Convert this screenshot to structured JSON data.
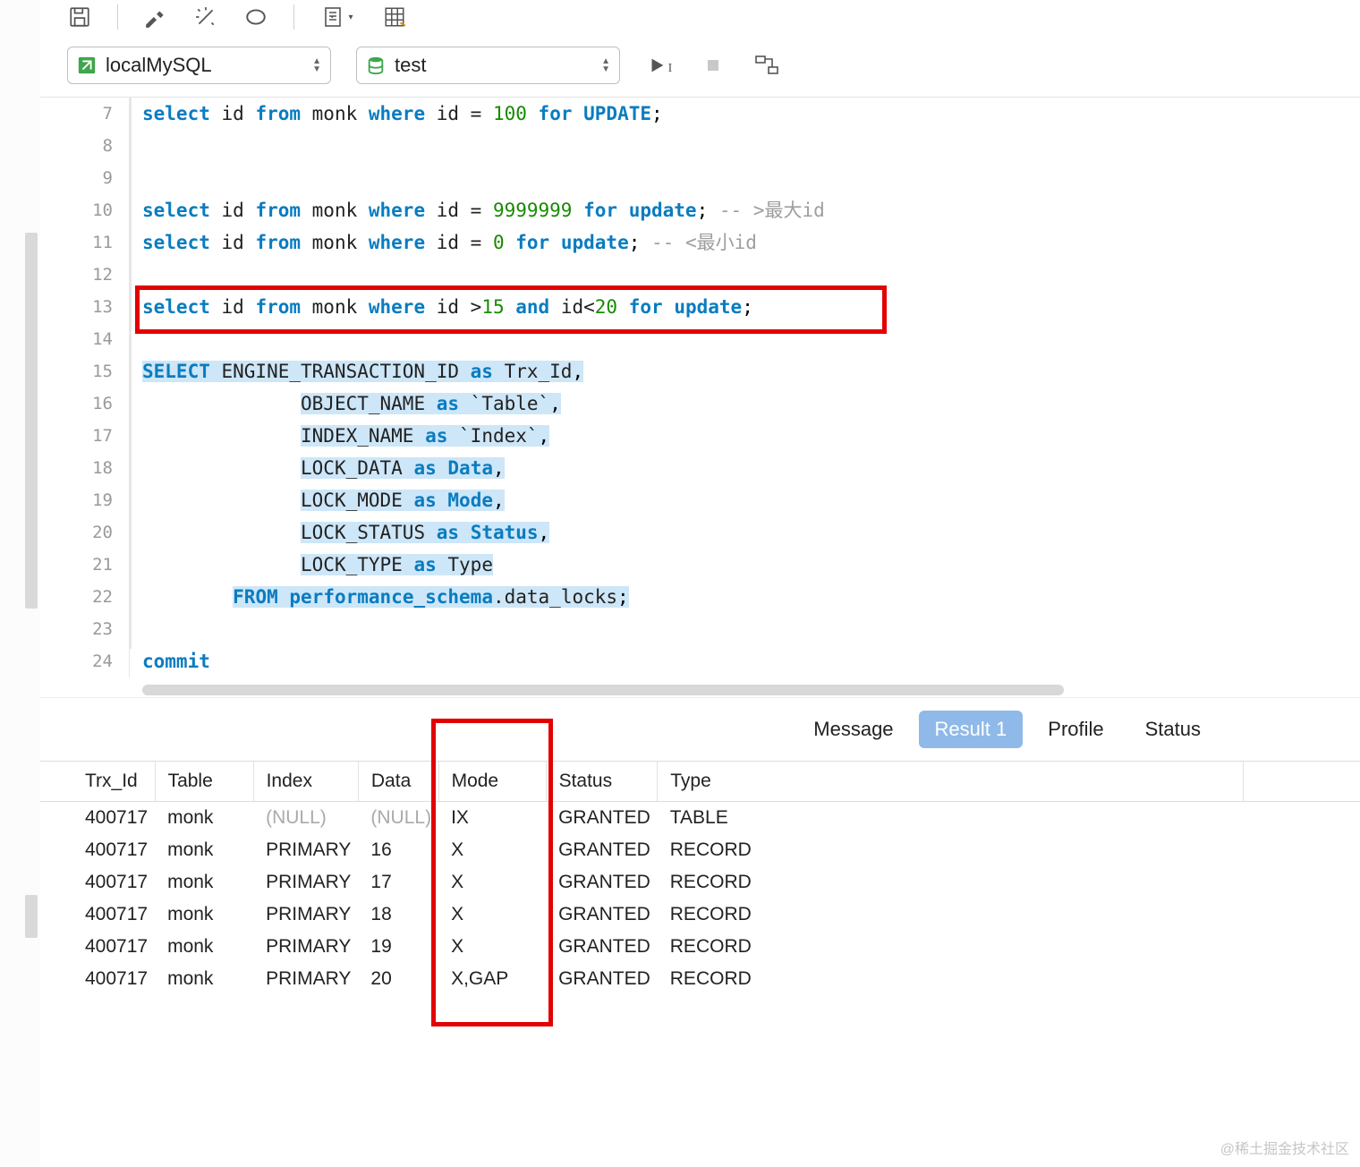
{
  "toolbar": {
    "connection": "localMySQL",
    "database": "test"
  },
  "icons": {
    "save": "save-icon",
    "hammer": "hammer-icon",
    "magic": "magic-icon",
    "loop": "loop-icon",
    "newdoc": "newdoc-icon",
    "sheet": "sheet-icon",
    "run": "run-icon",
    "stop": "stop-icon",
    "plan": "plan-icon",
    "db": "db-icon",
    "conn": "conn-icon"
  },
  "editor": {
    "first_line_no": 7,
    "lines": [
      {
        "n": 7,
        "tokens": [
          [
            "kw",
            "select"
          ],
          [
            "plain",
            " id "
          ],
          [
            "kw",
            "from"
          ],
          [
            "plain",
            " monk "
          ],
          [
            "kw",
            "where"
          ],
          [
            "plain",
            " id = "
          ],
          [
            "num",
            "100"
          ],
          [
            "plain",
            " "
          ],
          [
            "kw",
            "for"
          ],
          [
            "plain",
            " "
          ],
          [
            "kw",
            "UPDATE"
          ],
          [
            "punc",
            ";"
          ]
        ]
      },
      {
        "n": 8,
        "tokens": []
      },
      {
        "n": 9,
        "tokens": []
      },
      {
        "n": 10,
        "tokens": [
          [
            "kw",
            "select"
          ],
          [
            "plain",
            " id "
          ],
          [
            "kw",
            "from"
          ],
          [
            "plain",
            " monk "
          ],
          [
            "kw",
            "where"
          ],
          [
            "plain",
            " id = "
          ],
          [
            "num",
            "9999999"
          ],
          [
            "plain",
            " "
          ],
          [
            "kw",
            "for"
          ],
          [
            "plain",
            " "
          ],
          [
            "kw",
            "update"
          ],
          [
            "punc",
            ";"
          ],
          [
            "plain",
            " "
          ],
          [
            "cmt",
            "-- >最大id"
          ]
        ]
      },
      {
        "n": 11,
        "tokens": [
          [
            "kw",
            "select"
          ],
          [
            "plain",
            " id "
          ],
          [
            "kw",
            "from"
          ],
          [
            "plain",
            " monk "
          ],
          [
            "kw",
            "where"
          ],
          [
            "plain",
            " id = "
          ],
          [
            "num",
            "0"
          ],
          [
            "plain",
            " "
          ],
          [
            "kw",
            "for"
          ],
          [
            "plain",
            " "
          ],
          [
            "kw",
            "update"
          ],
          [
            "punc",
            ";"
          ],
          [
            "plain",
            " "
          ],
          [
            "cmt",
            "-- <最小id"
          ]
        ]
      },
      {
        "n": 12,
        "tokens": []
      },
      {
        "n": 13,
        "highlight": true,
        "tokens": [
          [
            "kw",
            "select"
          ],
          [
            "plain",
            " id "
          ],
          [
            "kw",
            "from"
          ],
          [
            "plain",
            " monk "
          ],
          [
            "kw",
            "where"
          ],
          [
            "plain",
            " id >"
          ],
          [
            "num",
            "15"
          ],
          [
            "plain",
            " "
          ],
          [
            "kw",
            "and"
          ],
          [
            "plain",
            " id<"
          ],
          [
            "num",
            "20"
          ],
          [
            "plain",
            " "
          ],
          [
            "kw",
            "for"
          ],
          [
            "plain",
            " "
          ],
          [
            "kw",
            "update"
          ],
          [
            "punc",
            ";"
          ]
        ]
      },
      {
        "n": 14,
        "tokens": []
      },
      {
        "n": 15,
        "selected": true,
        "tokens": [
          [
            "kw",
            "SELECT"
          ],
          [
            "plain",
            " ENGINE_TRANSACTION_ID "
          ],
          [
            "kw",
            "as"
          ],
          [
            "plain",
            " Trx_Id"
          ],
          [
            "punc",
            ","
          ]
        ]
      },
      {
        "n": 16,
        "selected": true,
        "indent": "              ",
        "tokens": [
          [
            "plain",
            "OBJECT_NAME "
          ],
          [
            "kw",
            "as"
          ],
          [
            "plain",
            " `Table`"
          ],
          [
            "punc",
            ","
          ]
        ]
      },
      {
        "n": 17,
        "selected": true,
        "indent": "              ",
        "tokens": [
          [
            "plain",
            "INDEX_NAME "
          ],
          [
            "kw",
            "as"
          ],
          [
            "plain",
            " `Index`"
          ],
          [
            "punc",
            ","
          ]
        ]
      },
      {
        "n": 18,
        "selected": true,
        "indent": "              ",
        "tokens": [
          [
            "plain",
            "LOCK_DATA "
          ],
          [
            "kw",
            "as"
          ],
          [
            "plain",
            " "
          ],
          [
            "kw",
            "Data"
          ],
          [
            "punc",
            ","
          ]
        ]
      },
      {
        "n": 19,
        "selected": true,
        "indent": "              ",
        "tokens": [
          [
            "plain",
            "LOCK_MODE "
          ],
          [
            "kw",
            "as"
          ],
          [
            "plain",
            " "
          ],
          [
            "kw",
            "Mode"
          ],
          [
            "punc",
            ","
          ]
        ]
      },
      {
        "n": 20,
        "selected": true,
        "indent": "              ",
        "tokens": [
          [
            "plain",
            "LOCK_STATUS "
          ],
          [
            "kw",
            "as"
          ],
          [
            "plain",
            " "
          ],
          [
            "kw",
            "Status"
          ],
          [
            "punc",
            ","
          ]
        ]
      },
      {
        "n": 21,
        "selected": true,
        "indent": "              ",
        "tokens": [
          [
            "plain",
            "LOCK_TYPE "
          ],
          [
            "kw",
            "as"
          ],
          [
            "plain",
            " Type"
          ]
        ]
      },
      {
        "n": 22,
        "selected": true,
        "indent": "        ",
        "tokens": [
          [
            "kw",
            "FROM"
          ],
          [
            "plain",
            " "
          ],
          [
            "kw",
            "performance_schema"
          ],
          [
            "plain",
            ".data_locks"
          ],
          [
            "punc",
            ";"
          ]
        ]
      },
      {
        "n": 23,
        "tokens": []
      },
      {
        "n": 24,
        "tokens": [
          [
            "kw",
            "commit"
          ]
        ]
      }
    ]
  },
  "tabs": [
    {
      "label": "Message",
      "active": false
    },
    {
      "label": "Result 1",
      "active": true
    },
    {
      "label": "Profile",
      "active": false
    },
    {
      "label": "Status",
      "active": false
    }
  ],
  "results": {
    "columns": [
      "Trx_Id",
      "Table",
      "Index",
      "Data",
      "Mode",
      "Status",
      "Type"
    ],
    "rows": [
      [
        "400717",
        "monk",
        "(NULL)",
        "(NULL)",
        "IX",
        "GRANTED",
        "TABLE"
      ],
      [
        "400717",
        "monk",
        "PRIMARY",
        "16",
        "X",
        "GRANTED",
        "RECORD"
      ],
      [
        "400717",
        "monk",
        "PRIMARY",
        "17",
        "X",
        "GRANTED",
        "RECORD"
      ],
      [
        "400717",
        "monk",
        "PRIMARY",
        "18",
        "X",
        "GRANTED",
        "RECORD"
      ],
      [
        "400717",
        "monk",
        "PRIMARY",
        "19",
        "X",
        "GRANTED",
        "RECORD"
      ],
      [
        "400717",
        "monk",
        "PRIMARY",
        "20",
        "X,GAP",
        "GRANTED",
        "RECORD"
      ]
    ]
  },
  "watermark": "@稀土掘金技术社区"
}
